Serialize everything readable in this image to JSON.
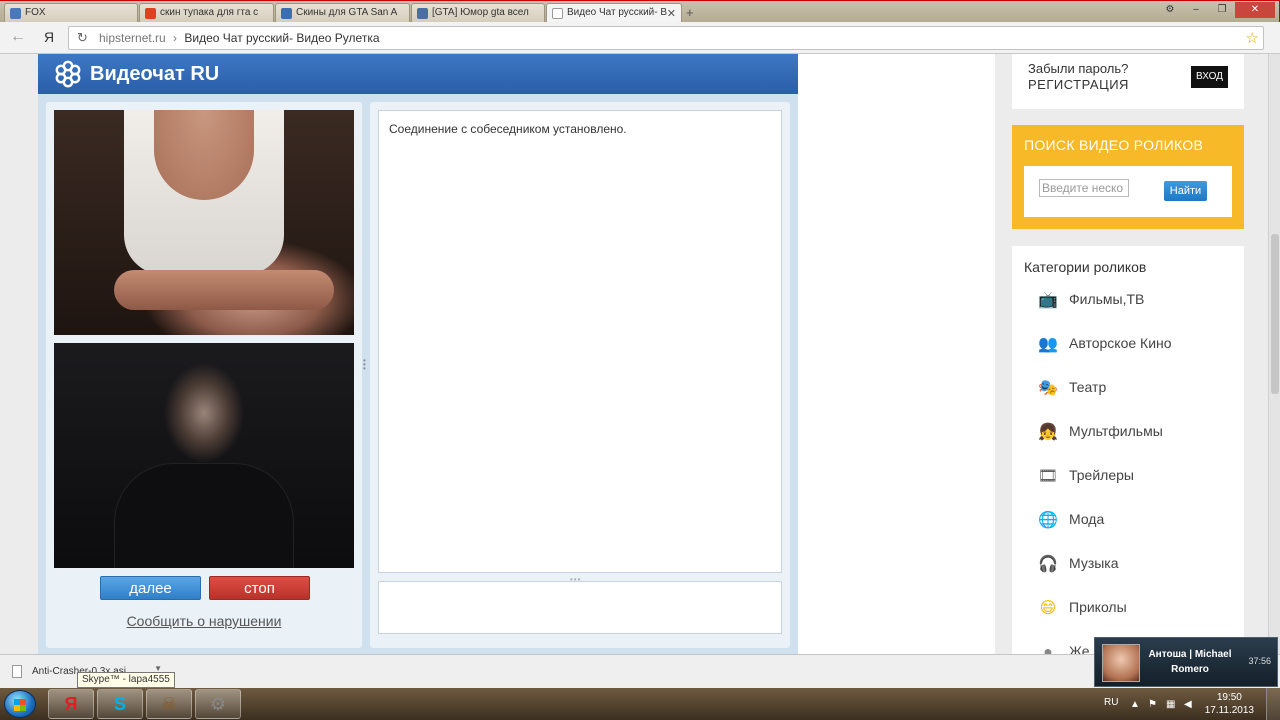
{
  "browser": {
    "tabs": [
      {
        "label": "FOX",
        "icon_color": "#4a78b8"
      },
      {
        "label": "скин тупака для гта с",
        "icon_color": "#e04020"
      },
      {
        "label": "Скины для GTA San A",
        "icon_color": "#3a70b0"
      },
      {
        "label": "[GTA] Юмор gta всел",
        "icon_color": "#4a6fa0"
      },
      {
        "label": "Видео Чат русский- В",
        "icon_color": "#ffffff"
      }
    ],
    "new_tab": "+",
    "window_buttons": {
      "settings": "⚙",
      "minimize": "–",
      "restore": "❐",
      "close": "✕"
    },
    "address": {
      "host": "hipsternet.ru",
      "separator": "›",
      "title": "Видео Чат русский- Видео Рулетка"
    },
    "nav": {
      "back": "←",
      "yandex": "Я",
      "reload": "↻",
      "bookmark": "☆"
    }
  },
  "videochat": {
    "title": "Видеочат RU",
    "status_message": "Соединение с собеседником установлено.",
    "next_label": "далее",
    "stop_label": "стоп",
    "report_label": "Сообщить о нарушении"
  },
  "sidebar": {
    "forgot_password": "Забыли пароль?",
    "register": "РЕГИСТРАЦИЯ",
    "login": "ВХОД",
    "search": {
      "title": "ПОИСК ВИДЕО РОЛИКОВ",
      "placeholder": "Введите неско",
      "button": "Найти"
    },
    "categories_title": "Категории роликов",
    "categories": [
      {
        "label": "Фильмы,ТВ",
        "icon": "tv-icon",
        "glyph": "📺",
        "color": "#2a7fd0"
      },
      {
        "label": "Авторское Кино",
        "icon": "people-icon",
        "glyph": "👥",
        "color": "#3b8d3b"
      },
      {
        "label": "Театр",
        "icon": "theater-icon",
        "glyph": "🎭",
        "color": "#e060a0"
      },
      {
        "label": "Мультфильмы",
        "icon": "cartoon-icon",
        "glyph": "👧",
        "color": "#4a90d0"
      },
      {
        "label": "Трейлеры",
        "icon": "film-icon",
        "glyph": "🎞",
        "color": "#555555"
      },
      {
        "label": "Мода",
        "icon": "globe-icon",
        "glyph": "🌐",
        "color": "#2a6fb0"
      },
      {
        "label": "Музыка",
        "icon": "headphones-icon",
        "glyph": "🎧",
        "color": "#333333"
      },
      {
        "label": "Приколы",
        "icon": "smiley-icon",
        "glyph": "😄",
        "color": "#f5b800"
      },
      {
        "label": "Же",
        "icon": "partial-icon",
        "glyph": "●",
        "color": "#888888"
      }
    ]
  },
  "download_bar": {
    "file": "Anti-Crasher-0.3x.asi",
    "tooltip": "Skype™ - lapa4555"
  },
  "notification": {
    "name": "Антоша | Michael Romero",
    "time": "37:56"
  },
  "taskbar": {
    "apps": [
      {
        "label": "Я",
        "icon": "yandex-browser-icon",
        "color": "#e02020"
      },
      {
        "label": "S",
        "icon": "skype-icon",
        "color": "#00aff0"
      },
      {
        "label": "☠",
        "icon": "gta-icon",
        "color": "#8a5a2a"
      },
      {
        "label": "⚙",
        "icon": "settings-app-icon",
        "color": "#888888"
      }
    ],
    "lang": "RU",
    "time": "19:50",
    "date": "17.11.2013"
  },
  "colors": {
    "header_blue": "#2f66b0",
    "accent_orange": "#f7b928",
    "next_blue": "#2f7fc8",
    "stop_red": "#c0392b"
  }
}
